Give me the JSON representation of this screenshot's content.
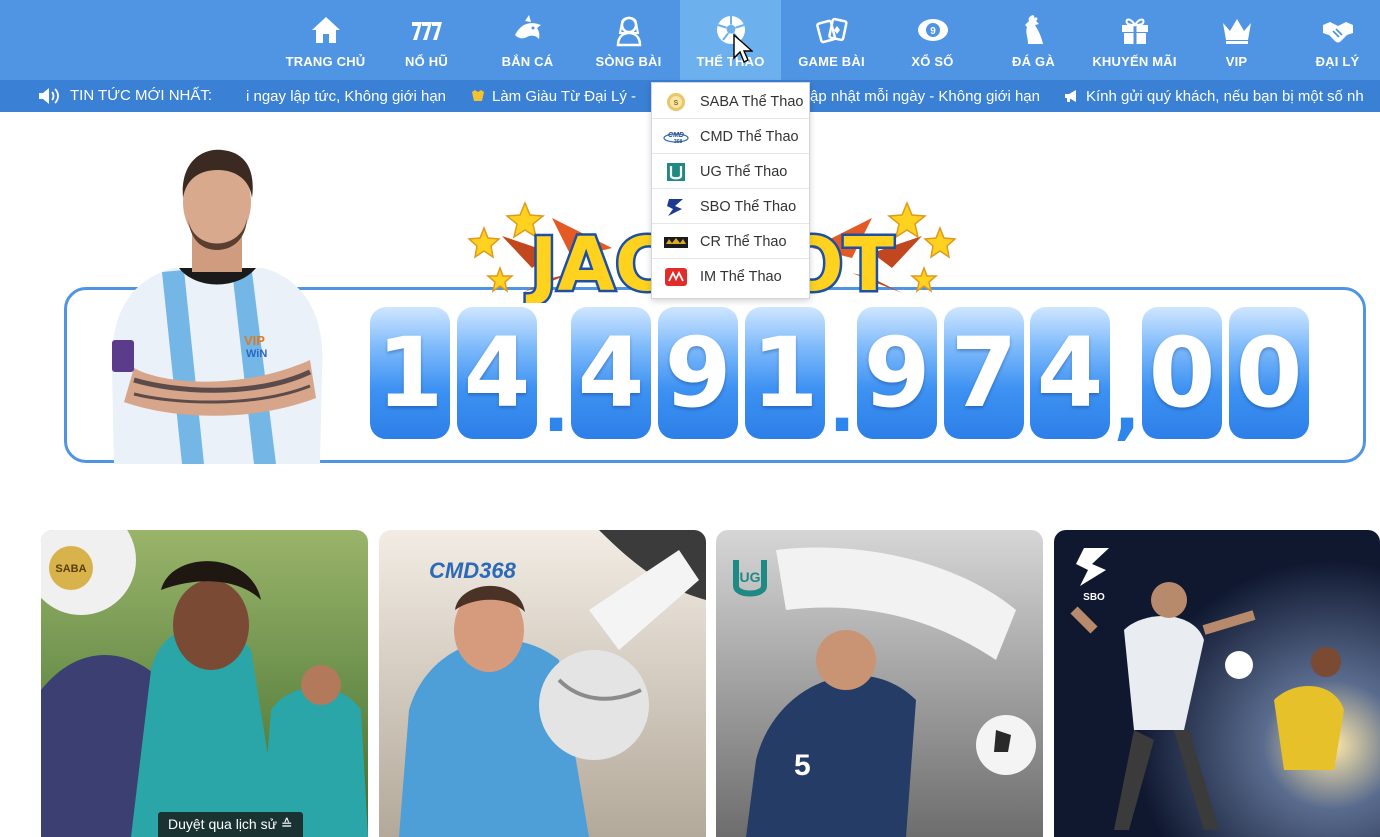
{
  "nav": {
    "items": [
      {
        "label": "TRANG CHỦ",
        "icon": "home-icon"
      },
      {
        "label": "NỔ HŨ",
        "icon": "slot-777-icon"
      },
      {
        "label": "BẮN CÁ",
        "icon": "shark-icon"
      },
      {
        "label": "SÒNG BÀI",
        "icon": "dealer-icon"
      },
      {
        "label": "THỂ THAO",
        "icon": "soccer-ball-icon",
        "active": true
      },
      {
        "label": "GAME BÀI",
        "icon": "playing-cards-icon"
      },
      {
        "label": "XỔ SỐ",
        "icon": "lottery-ball-icon"
      },
      {
        "label": "ĐÁ GÀ",
        "icon": "rooster-icon"
      },
      {
        "label": "KHUYẾN MÃI",
        "icon": "gift-icon"
      },
      {
        "label": "VIP",
        "icon": "crown-icon"
      },
      {
        "label": "ĐẠI LÝ",
        "icon": "handshake-icon"
      }
    ]
  },
  "news": {
    "title": "TIN TỨC MỚI NHẤT:",
    "items": [
      "i ngay lập tức, Không giới hạn",
      "Làm Giàu Từ Đại Lý -",
      "ập nhật mỗi ngày - Không giới hạn",
      "Kính gửi quý khách, nếu bạn bị một số nh"
    ]
  },
  "dropdown": {
    "items": [
      {
        "label": "SABA Thể Thao",
        "logo": "saba-logo-icon"
      },
      {
        "label": "CMD Thể Thao",
        "logo": "cmd368-logo-icon"
      },
      {
        "label": "UG Thể Thao",
        "logo": "ug-logo-icon"
      },
      {
        "label": "SBO Thể Thao",
        "logo": "sbo-logo-icon"
      },
      {
        "label": "CR Thể Thao",
        "logo": "crown-sports-logo-icon"
      },
      {
        "label": "IM Thể Thao",
        "logo": "im-logo-icon"
      }
    ]
  },
  "jackpot": {
    "logo_text": "JACKPOT",
    "chars": [
      "1",
      "4",
      ".",
      "4",
      "9",
      "1",
      ".",
      "9",
      "7",
      "4",
      ",",
      "0",
      "0"
    ]
  },
  "cards": [
    {
      "logo": "SABA"
    },
    {
      "logo": "CMD368"
    },
    {
      "logo": "UG"
    },
    {
      "logo": "SBO"
    }
  ],
  "tooltip": "Duyệt qua lịch sử ≙",
  "colors": {
    "nav_bg": "#4f95e4",
    "nav_active": "#6db0ee",
    "news_bg": "#3a80d4",
    "digit_blue": "#3e92f2"
  }
}
